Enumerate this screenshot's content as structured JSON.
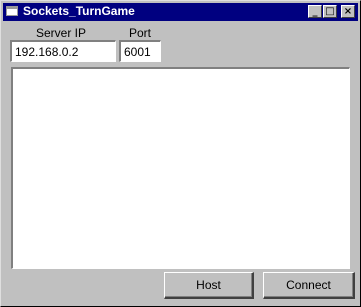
{
  "window": {
    "title": "Sockets_TurnGame",
    "minimize_glyph": "_",
    "maximize_glyph": "□",
    "close_glyph": "×"
  },
  "connection": {
    "server_ip_label": "Server IP",
    "server_ip_value": "192.168.0.2",
    "port_label": "Port",
    "port_value": "6001"
  },
  "output": {
    "text": ""
  },
  "buttons": {
    "host_label": "Host",
    "connect_label": "Connect"
  }
}
